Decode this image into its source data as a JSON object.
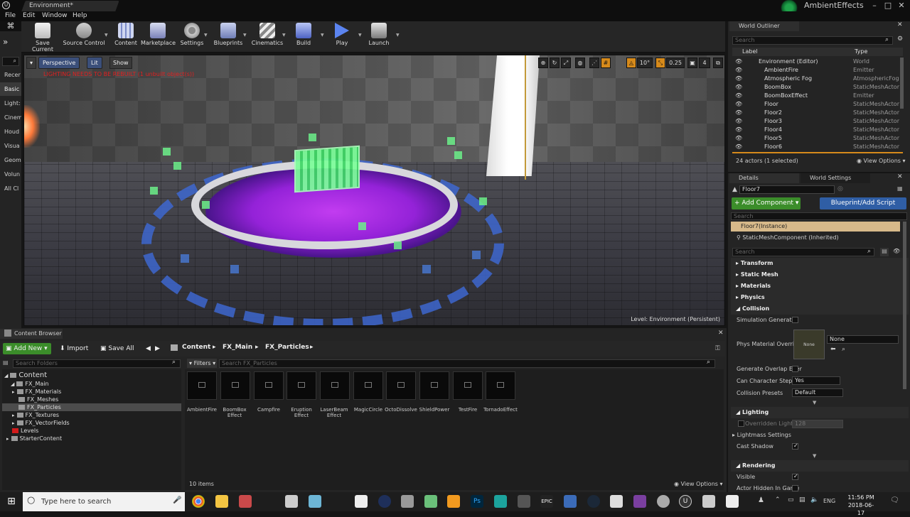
{
  "window": {
    "doc_tab": "Environment*",
    "project": "AmbientEffects"
  },
  "menu": [
    "File",
    "Edit",
    "Window",
    "Help"
  ],
  "modes_categories": [
    "Recer",
    "Basic",
    "Light:",
    "Cinem",
    "Houd",
    "Visua",
    "Geom",
    "Volun",
    "All Cl"
  ],
  "toolbar": {
    "items": [
      "Save Current",
      "Source Control",
      "Content",
      "Marketplace",
      "Settings",
      "Blueprints",
      "Cinematics",
      "Build",
      "Play",
      "Launch"
    ]
  },
  "viewport": {
    "perspective": "Perspective",
    "lit": "Lit",
    "show": "Show",
    "warning": "LIGHTING NEEDS TO BE REBUILT (1 unbuilt object(s))",
    "level": "Level:  Environment (Persistent)",
    "snap_angle": "10°",
    "snap_scale": "0.25",
    "camera_speed": "4"
  },
  "outliner": {
    "tab": "World Outliner",
    "search_placeholder": "Search",
    "col_label": "Label",
    "col_type": "Type",
    "rows": [
      {
        "name": "Environment (Editor)",
        "type": "World"
      },
      {
        "name": "AmbientFire",
        "type": "Emitter"
      },
      {
        "name": "Atmospheric Fog",
        "type": "AtmosphericFog"
      },
      {
        "name": "BoomBox",
        "type": "StaticMeshActor"
      },
      {
        "name": "BoomBoxEffect",
        "type": "Emitter"
      },
      {
        "name": "Floor",
        "type": "StaticMeshActor"
      },
      {
        "name": "Floor2",
        "type": "StaticMeshActor"
      },
      {
        "name": "Floor3",
        "type": "StaticMeshActor"
      },
      {
        "name": "Floor4",
        "type": "StaticMeshActor"
      },
      {
        "name": "Floor5",
        "type": "StaticMeshActor"
      },
      {
        "name": "Floor6",
        "type": "StaticMeshActor"
      }
    ],
    "count": "24 actors (1 selected)",
    "view_options": "View Options"
  },
  "details": {
    "tab": "Details",
    "world_tab": "World Settings",
    "actor_name": "Floor7",
    "add_component": "+ Add Component",
    "blueprint_btn": "Blueprint/Add Script",
    "search_placeholder": "Search",
    "instance": "Floor7(Instance)",
    "component": "StaticMeshComponent (Inherited)",
    "sections": [
      "Transform",
      "Static Mesh",
      "Materials",
      "Physics",
      "Collision"
    ],
    "collision": {
      "sim_generates": "Simulation Generates",
      "phys_material": "Phys Material Overrid",
      "phys_none": "None",
      "phys_thumb": "None",
      "gen_overlap": "Generate Overlap Ever",
      "char_step": "Can Character Step Up",
      "char_step_val": "Yes",
      "presets": "Collision Presets",
      "presets_val": "Default"
    },
    "lighting_section": "Lighting",
    "lighting": {
      "overridden": "Overridden Light M",
      "overridden_val": "128",
      "lightmass": "Lightmass Settings",
      "cast_shadow": "Cast Shadow"
    },
    "rendering_section": "Rendering",
    "rendering": {
      "visible": "Visible",
      "hidden": "Actor Hidden In Game"
    }
  },
  "content_browser": {
    "tab": "Content Browser",
    "add_new": "Add New",
    "import": "Import",
    "save_all": "Save All",
    "breadcrumb": [
      "Content",
      "FX_Main",
      "FX_Particles"
    ],
    "search_folders": "Search Folders",
    "filters": "Filters",
    "search_assets": "Search FX_Particles",
    "tree": [
      {
        "label": "Content",
        "depth": 0
      },
      {
        "label": "FX_Main",
        "depth": 1
      },
      {
        "label": "FX_Materials",
        "depth": 2
      },
      {
        "label": "FX_Meshes",
        "depth": 2
      },
      {
        "label": "FX_Particles",
        "depth": 2
      },
      {
        "label": "FX_Textures",
        "depth": 2
      },
      {
        "label": "FX_VectorFields",
        "depth": 2
      },
      {
        "label": "Levels",
        "depth": 1
      },
      {
        "label": "StarterContent",
        "depth": 1
      }
    ],
    "assets": [
      "AmbientFire",
      "BoomBox Effect",
      "Campfire",
      "Eruption Effect",
      "LaserBeam Effect",
      "MagicCircle",
      "OctoDissolve",
      "ShieldPower",
      "TestFire",
      "TornadoEffect"
    ],
    "item_count": "10 items",
    "view_options": "View Options"
  },
  "taskbar": {
    "search_placeholder": "Type here to search",
    "lang": "ENG",
    "time": "11:56 PM",
    "date": "2018-06-17"
  }
}
